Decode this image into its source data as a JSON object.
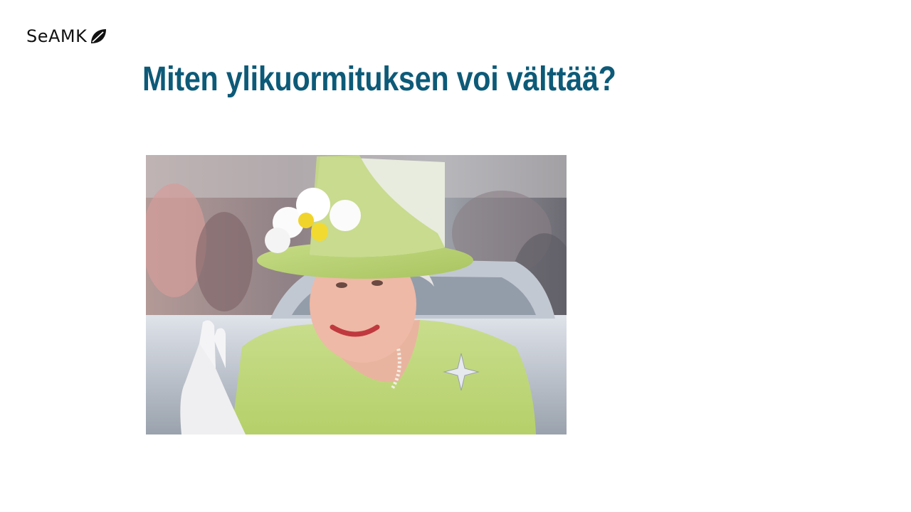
{
  "logo": {
    "text": "SeAMK",
    "icon": "leaf-icon"
  },
  "slide": {
    "title": "Miten ylikuormituksen voi välttää?"
  },
  "photo": {
    "subject": "waving-woman-in-green-hat"
  },
  "colors": {
    "title": "#0d5a78",
    "logo_text": "#111111"
  }
}
